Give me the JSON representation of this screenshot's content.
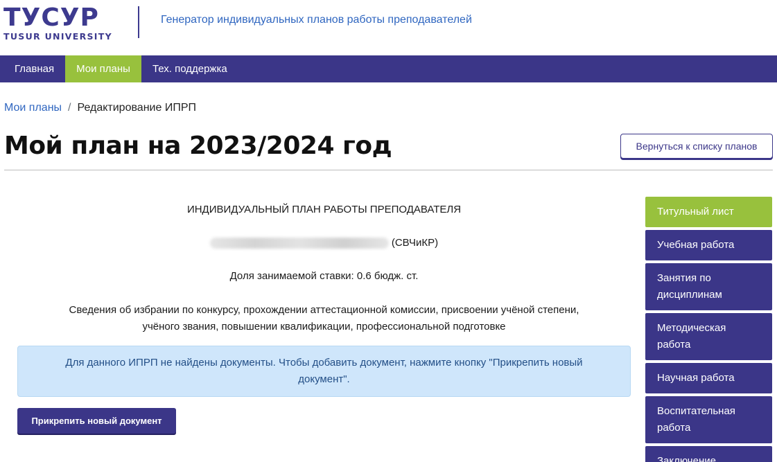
{
  "header": {
    "logo_main": "ТУСУР",
    "logo_sub": "TUSUR UNIVERSITY",
    "site_title": "Генератор индивидуальных планов работы преподавателей"
  },
  "nav": {
    "items": [
      {
        "label": "Главная"
      },
      {
        "label": "Мои планы"
      },
      {
        "label": "Тех. поддержка"
      }
    ]
  },
  "breadcrumb": {
    "link": "Мои планы",
    "separator": "/",
    "current": "Редактирование ИПРП"
  },
  "page": {
    "title": "Мой план на 2023/2024 год",
    "back_button": "Вернуться к списку планов"
  },
  "main": {
    "heading": "ИНДИВИДУАЛЬНЫЙ ПЛАН РАБОТЫ ПРЕПОДАВАТЕЛЯ",
    "department": "(СВЧиКР)",
    "rate": "Доля занимаемой ставки: 0.6 бюдж. ст.",
    "info_line1": "Сведения об избрании по конкурсу, прохождении аттестационной комиссии, присвоении учёной степени,",
    "info_line2": "учёного звания, повышении квалификации, профессиональной подготовке",
    "alert": "Для данного ИПРП не найдены документы. Чтобы добавить документ, нажмите кнопку \"Прикрепить новый документ\".",
    "attach_button": "Прикрепить новый документ"
  },
  "sidebar": {
    "items": [
      {
        "label": "Титульный лист"
      },
      {
        "label": "Учебная работа"
      },
      {
        "label": "Занятия по дисциплинам"
      },
      {
        "label": "Методическая работа"
      },
      {
        "label": "Научная работа"
      },
      {
        "label": "Воспитательная работа"
      },
      {
        "label": "Заключение"
      }
    ]
  },
  "colors": {
    "brand_purple": "#3b3688",
    "active_green": "#98c13d",
    "link_blue": "#2f66c0",
    "alert_bg": "#cfe6fb"
  }
}
